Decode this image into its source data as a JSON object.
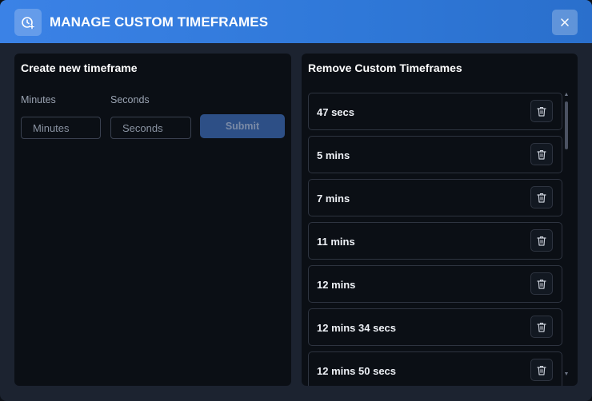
{
  "header": {
    "title": "MANAGE CUSTOM TIMEFRAMES",
    "icon": "clock-plus-icon",
    "close_icon": "close-icon"
  },
  "create": {
    "title": "Create new timeframe",
    "minutes_label": "Minutes",
    "seconds_label": "Seconds",
    "minutes_placeholder": "Minutes",
    "seconds_placeholder": "Seconds",
    "submit_label": "Submit"
  },
  "remove": {
    "title": "Remove Custom Timeframes",
    "items": [
      {
        "label": "47 secs"
      },
      {
        "label": "5 mins"
      },
      {
        "label": "7 mins"
      },
      {
        "label": "11 mins"
      },
      {
        "label": "12 mins"
      },
      {
        "label": "12 mins 34 secs"
      },
      {
        "label": "12 mins 50 secs"
      }
    ],
    "delete_icon": "trash-icon"
  },
  "colors": {
    "header_accent": "#3b82e6",
    "panel_bg": "#0b0f15",
    "submit_bg": "#2d4f86"
  }
}
